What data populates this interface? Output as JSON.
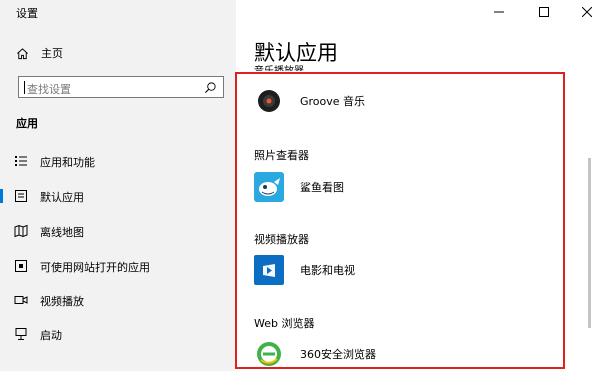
{
  "window": {
    "title": "设置",
    "controls": [
      "minimize",
      "maximize",
      "close"
    ]
  },
  "sidebar": {
    "home_label": "主页",
    "search_placeholder": "查找设置",
    "section_label": "应用",
    "items": [
      {
        "label": "应用和功能",
        "icon": "apps-list-icon",
        "selected": false
      },
      {
        "label": "默认应用",
        "icon": "default-apps-icon",
        "selected": true
      },
      {
        "label": "离线地图",
        "icon": "offline-map-icon",
        "selected": false
      },
      {
        "label": "可使用网站打开的应用",
        "icon": "web-apps-icon",
        "selected": false
      },
      {
        "label": "视频播放",
        "icon": "video-icon",
        "selected": false
      },
      {
        "label": "启动",
        "icon": "startup-icon",
        "selected": false
      }
    ]
  },
  "main": {
    "title": "默认应用",
    "clipped_label": "音乐播放器",
    "categories": [
      {
        "label": "",
        "app": "Groove 音乐",
        "icon": "groove-music-icon"
      },
      {
        "label": "照片查看器",
        "app": "鲨鱼看图",
        "icon": "shark-viewer-icon"
      },
      {
        "label": "视频播放器",
        "app": "电影和电视",
        "icon": "movies-tv-icon"
      },
      {
        "label": "Web 浏览器",
        "app": "360安全浏览器",
        "icon": "browser-360-icon"
      }
    ]
  },
  "colors": {
    "sidebar_bg": "#f2f2f2",
    "accent": "#0078d7",
    "highlight_frame": "#e02020"
  }
}
